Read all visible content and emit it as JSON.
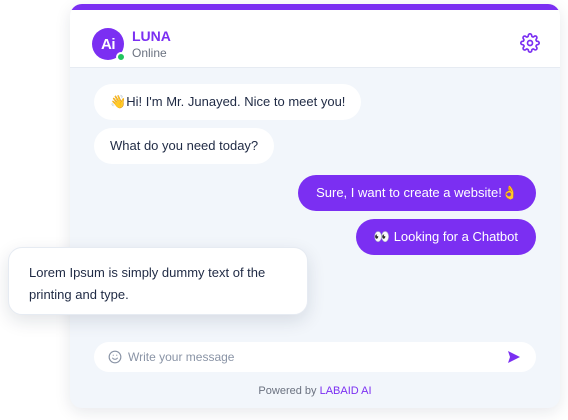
{
  "header": {
    "avatar_text": "Ai",
    "name": "LUNA",
    "status": "Online"
  },
  "messages": [
    {
      "from": "bot",
      "emoji": "👋",
      "text": "Hi! I'm Mr. Junayed. Nice to meet you!"
    },
    {
      "from": "bot",
      "emoji": "",
      "text": "What do you need today?"
    },
    {
      "from": "user",
      "text": "Sure, I want to create a website!",
      "emoji": "👌"
    },
    {
      "from": "user",
      "emoji": "👀",
      "text": "Looking for a Chatbot"
    }
  ],
  "input": {
    "placeholder": "Write your message",
    "value": ""
  },
  "footer": {
    "powered_prefix": "Powered by",
    "brand": "LABAID AI"
  },
  "callout": {
    "text": "Lorem Ipsum is simply dummy text of the printing and type."
  },
  "icons": {
    "settings": "gear-icon",
    "emoji": "smile-icon",
    "send": "send-icon"
  },
  "colors": {
    "accent": "#7b2ff2",
    "online": "#22c55e",
    "panel_bg": "#f2f6fb"
  }
}
